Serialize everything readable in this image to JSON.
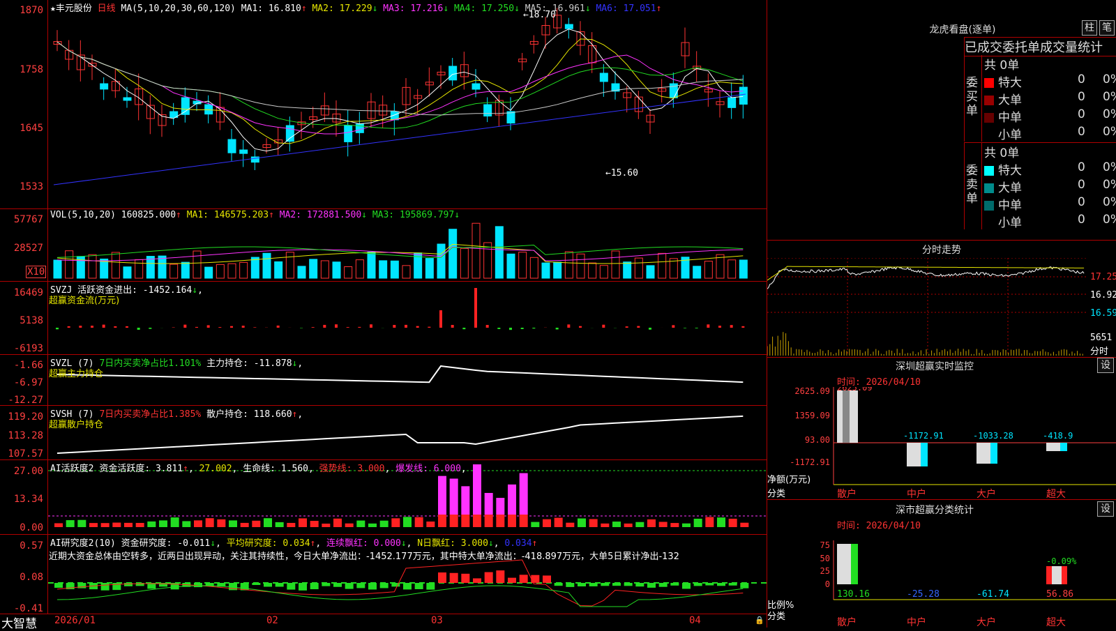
{
  "stock": {
    "star": "★",
    "name": "丰元股份",
    "period": "日线"
  },
  "colors": {
    "up": "#ff3333",
    "down": "#00e5ff",
    "grid": "#b00000",
    "ma1": "#ffffff",
    "ma2": "#e6e600",
    "ma3": "#ff33ff",
    "ma4": "#22dd22",
    "ma5": "#cccccc",
    "ma6": "#3333ff"
  },
  "main": {
    "ma_prefix": "MA(5,10,20,30,60,120)",
    "ma": [
      {
        "label": "MA1: 16.810",
        "arrow": "↑"
      },
      {
        "label": "MA2: 17.229",
        "arrow": "↓"
      },
      {
        "label": "MA3: 17.216",
        "arrow": "↓"
      },
      {
        "label": "MA4: 17.250",
        "arrow": "↓"
      },
      {
        "label": "MA5: 16.961",
        "arrow": "↓"
      },
      {
        "label": "MA6: 17.051",
        "arrow": "↑"
      }
    ],
    "y_ticks": [
      "1870",
      "1758",
      "1645",
      "1533"
    ],
    "high_mark": "18.70",
    "low_mark": "15.60"
  },
  "vol": {
    "title": "VOL(5,10,20)",
    "value": "160825.000",
    "arrow": "↑",
    "ma": [
      {
        "label": "MA1: 146575.203",
        "arrow": "↑"
      },
      {
        "label": "MA2: 172881.500",
        "arrow": "↓"
      },
      {
        "label": "MA3: 195869.797",
        "arrow": "↓"
      }
    ],
    "y_ticks": [
      "57767",
      "28527"
    ],
    "unit": "X10"
  },
  "svzj": {
    "title": "SVZJ",
    "line1": "活跃资金进出: -1452.164",
    "arrow": "↓",
    "line2": "超赢资金流(万元)",
    "y_ticks": [
      "16469",
      "5138",
      "-6193"
    ]
  },
  "svzl": {
    "title": "SVZL (7)",
    "ratio": "7日内买卖净占比1.101%",
    "label": "主力持仓: -11.878",
    "arrow": "↓",
    "line2": "超赢主力持仓",
    "y_ticks": [
      "-1.66",
      "-6.97",
      "-12.27"
    ]
  },
  "svsh": {
    "title": "SVSH (7)",
    "ratio": "7日内买卖净占比1.385%",
    "label": "散户持仓: 118.660",
    "arrow": "↑",
    "line2": "超赢散户持仓",
    "y_ticks": [
      "119.20",
      "113.28",
      "107.57"
    ]
  },
  "ai1": {
    "title": "AI活跃度2",
    "label": "资金活跃度: 3.811",
    "arrow1": "↑",
    "v2": "27.002",
    "life": "生命线: 1.560",
    "strong": "强势线: 3.000",
    "burst": "爆发线: 6.000",
    "y_ticks": [
      "27.00",
      "13.34",
      "0.00"
    ]
  },
  "ai2": {
    "title": "AI研究度2(10)",
    "label": "资金研究度: -0.011",
    "arrow1": "↓",
    "avg": "平均研究度: 0.034",
    "arrow2": "↑",
    "cont": "连续飘红: 0.000",
    "arrow3": "↓",
    "nday": "N日飘红: 3.000",
    "arrow4": "↓",
    "v5": "0.034",
    "arrow5": "↑",
    "comment": "近期大资金总体由空转多，近两日出现异动，关注其持续性，今日大单净流出：-1452.177万元，其中特大单净流出：-418.897万元，大单5日累计净出-132",
    "y_ticks": [
      "0.57",
      "0.08",
      "-0.41"
    ]
  },
  "xaxis": {
    "logo": "大智慧",
    "labels": [
      "2026/01",
      "02",
      "03",
      "04"
    ]
  },
  "right": {
    "lhb_title": "龙虎看盘(逐单)",
    "btn_bar": "柱",
    "btn_bi": "笔",
    "tabs": "已成交委托单成交量统计",
    "buy": {
      "side": "委买单",
      "total": "共 0单",
      "rows": [
        {
          "name": "特大",
          "count": "0",
          "pct": "0%",
          "color": "#ff0000"
        },
        {
          "name": "大单",
          "count": "0",
          "pct": "0%",
          "color": "#990000"
        },
        {
          "name": "中单",
          "count": "0",
          "pct": "0%",
          "color": "#660000"
        },
        {
          "name": "小单",
          "count": "0",
          "pct": "0%",
          "color": "#000000"
        }
      ]
    },
    "sell": {
      "side": "委卖单",
      "total": "共 0单",
      "rows": [
        {
          "name": "特大",
          "count": "0",
          "pct": "0%",
          "color": "#00ffff"
        },
        {
          "name": "大单",
          "count": "0",
          "pct": "0%",
          "color": "#008b8b"
        },
        {
          "name": "中单",
          "count": "0",
          "pct": "0%",
          "color": "#006b6b"
        },
        {
          "name": "小单",
          "count": "0",
          "pct": "0%",
          "color": "#000000"
        }
      ]
    },
    "intraday": {
      "title": "分时走势",
      "prices": [
        "17.25",
        "16.92",
        "16.59"
      ],
      "vol": "5651",
      "unit": "分时"
    },
    "monitor": {
      "title": "深圳超赢实时监控",
      "btn": "设",
      "time": "时间: 2026/04/10",
      "y_ticks": [
        "2625.09",
        "1359.09",
        "93.00",
        "-1172.91"
      ],
      "top_value": "2625.09",
      "values": [
        "-1172.91",
        "-1033.28",
        "-418.9"
      ],
      "ylabel": "净额(万元)",
      "xlabel": "分类",
      "cats": [
        "散户",
        "中户",
        "大户",
        "超大"
      ]
    },
    "stats": {
      "title": "深市超赢分类统计",
      "btn": "设",
      "time": "时间: 2026/04/10",
      "y_ticks": [
        "75",
        "50",
        "25",
        "0"
      ],
      "top_value": "-0.09%",
      "ylabel": "比例%",
      "xlabel": "分类",
      "values": [
        "130.16",
        "-25.28",
        "-61.74",
        "56.86"
      ],
      "cats": [
        "散户",
        "中户",
        "大户",
        "超大"
      ]
    }
  }
}
